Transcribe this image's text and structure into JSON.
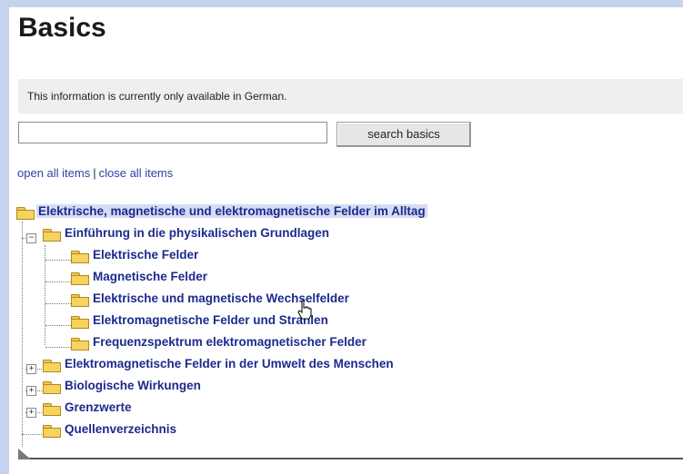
{
  "page": {
    "title": "Basics"
  },
  "info": {
    "text": "This information is currently only available in German."
  },
  "search": {
    "input_value": "",
    "button_label": "search basics"
  },
  "links": {
    "open_all": "open all items",
    "separator": "|",
    "close_all": "close all items"
  },
  "tree": {
    "root": "Elektrische, magnetische und elektromagnetische Felder im Alltag",
    "items": [
      "Einführung in die physikalischen Grundlagen",
      "Elektrische Felder",
      "Magnetische Felder",
      "Elektrische und magnetische Wechselfelder",
      "Elektromagnetische Felder und Strahlen",
      "Frequenzspektrum elektromagnetischer Felder",
      "Elektromagnetische Felder in der Umwelt des Menschen",
      "Biologische Wirkungen",
      "Grenzwerte",
      "Quellenverzeichnis"
    ],
    "expanders": {
      "collapse": "−",
      "expand": "+"
    }
  },
  "colors": {
    "background": "#c6d3ee",
    "link": "#1c2a8c",
    "folder": "#f6d35d",
    "root_highlight": "#d6dcf3"
  },
  "icons": {
    "folder": "folder-icon",
    "cursor": "hand-cursor-icon"
  }
}
